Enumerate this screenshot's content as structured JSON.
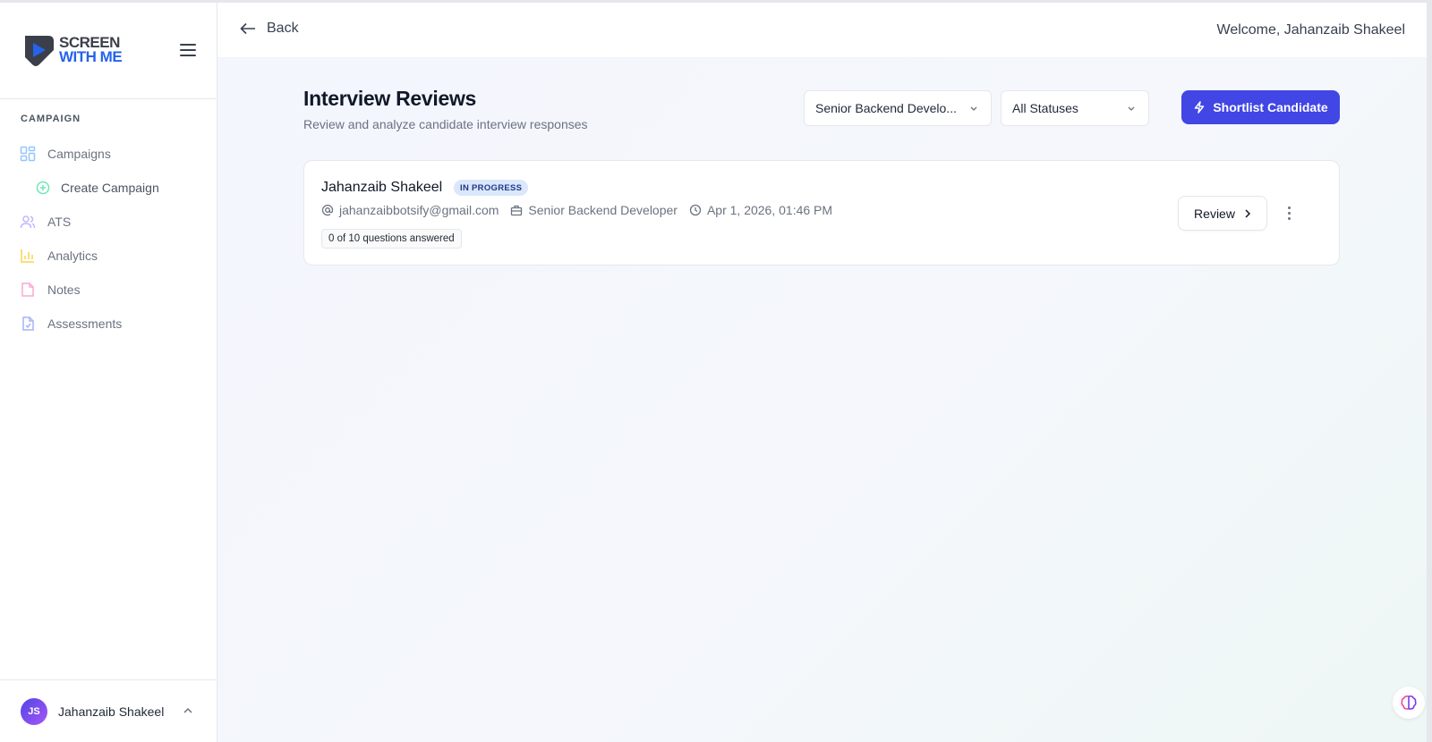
{
  "brand": {
    "line1": "SCREEN",
    "line2": "WITH ME"
  },
  "sidebar": {
    "section_label": "CAMPAIGN",
    "items": [
      {
        "label": "Campaigns",
        "icon": "grid-icon"
      },
      {
        "label": "Create Campaign",
        "icon": "plus-circle-icon"
      },
      {
        "label": "ATS",
        "icon": "users-icon"
      },
      {
        "label": "Analytics",
        "icon": "bar-chart-icon"
      },
      {
        "label": "Notes",
        "icon": "note-icon"
      },
      {
        "label": "Assessments",
        "icon": "file-check-icon"
      }
    ],
    "user": {
      "initials": "JS",
      "name": "Jahanzaib Shakeel"
    }
  },
  "topbar": {
    "back_label": "Back",
    "welcome": "Welcome, Jahanzaib Shakeel"
  },
  "page": {
    "title": "Interview Reviews",
    "subtitle": "Review and analyze candidate interview responses"
  },
  "filters": {
    "campaign_selected": "Senior Backend Develo...",
    "status_selected": "All Statuses"
  },
  "actions": {
    "shortlist_label": "Shortlist Candidate"
  },
  "candidates": [
    {
      "name": "Jahanzaib Shakeel",
      "status": "IN PROGRESS",
      "email": "jahanzaibbotsify@gmail.com",
      "role": "Senior Backend Developer",
      "datetime": "Apr 1, 2026, 01:46 PM",
      "progress": "0 of 10 questions answered",
      "review_label": "Review"
    }
  ],
  "colors": {
    "primary": "#4146e4",
    "badge_bg": "#dbe7fb",
    "badge_text": "#1e3a8a",
    "brand_blue": "#2563eb"
  }
}
